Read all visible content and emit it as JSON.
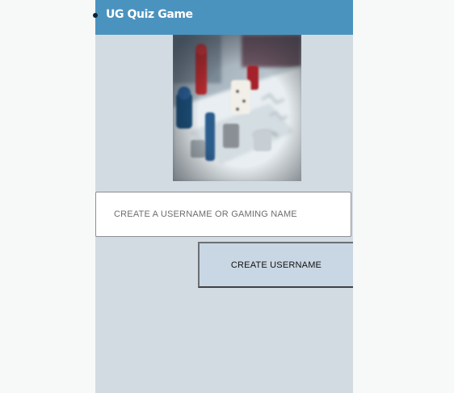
{
  "header": {
    "title": "UG Quiz Game"
  },
  "hero_image": {
    "icon": "board-game-image"
  },
  "username": {
    "placeholder": "CREATE A USERNAME OR GAMING NAME",
    "value": ""
  },
  "create_button": {
    "label": "CREATE USERNAME"
  },
  "colors": {
    "header": "#4b93bf",
    "app_background": "#d3dbe2",
    "page_background": "#f7f8f8",
    "button_background": "#c9d6e3"
  }
}
